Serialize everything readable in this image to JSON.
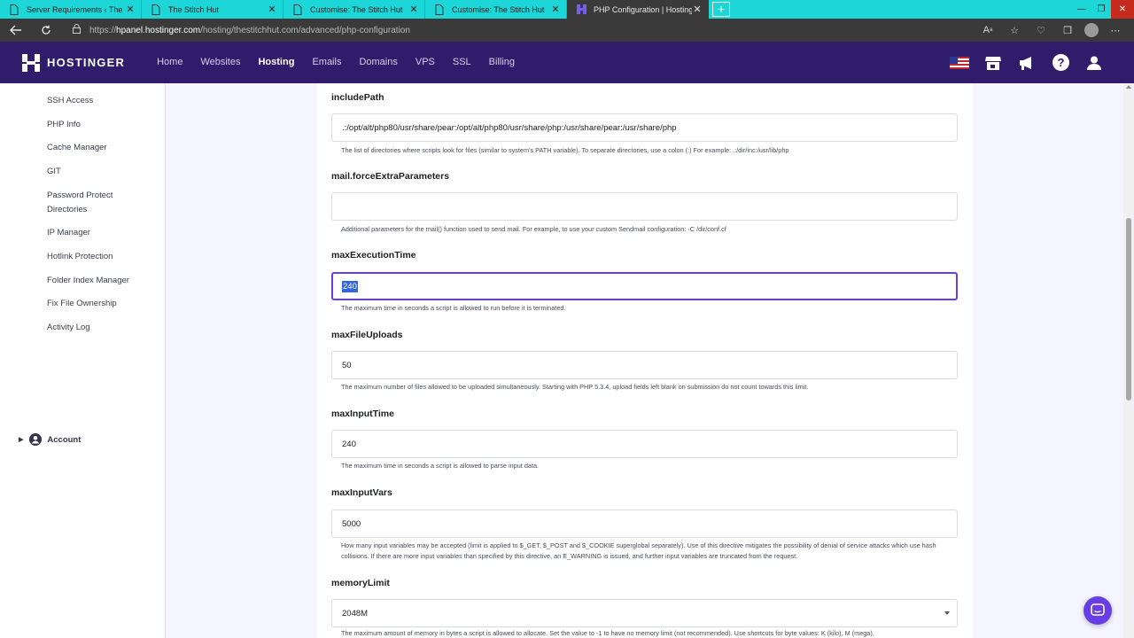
{
  "browser": {
    "tabs": [
      {
        "title": "Server Requirements ‹ The Stitch Hut",
        "active": false
      },
      {
        "title": "The Stitch Hut",
        "active": false
      },
      {
        "title": "Customise: The Stitch Hut",
        "active": false
      },
      {
        "title": "Customise: The Stitch Hut",
        "active": false
      },
      {
        "title": "PHP Configuration | Hostinger",
        "active": true
      }
    ],
    "new_tab": "+",
    "url_scheme": "https://",
    "url_host": "hpanel.hostinger.com",
    "url_path": "/hosting/thestitchhut.com/advanced/php-configuration"
  },
  "header": {
    "logo_text": "HOSTINGER",
    "nav": [
      "Home",
      "Websites",
      "Hosting",
      "Emails",
      "Domains",
      "VPS",
      "SSL",
      "Billing"
    ],
    "active_nav": "Hosting",
    "icons": [
      "us-flag-icon",
      "store-icon",
      "megaphone-icon",
      "help-icon",
      "user-icon"
    ]
  },
  "sidebar": {
    "items": [
      "SSH Access",
      "PHP Info",
      "Cache Manager",
      "GIT",
      "Password Protect Directories",
      "IP Manager",
      "Hotlink Protection",
      "Folder Index Manager",
      "Fix File Ownership",
      "Activity Log"
    ],
    "account_label": "Account"
  },
  "fields": {
    "includePath": {
      "label": "includePath",
      "value": ".:/opt/alt/php80/usr/share/pear:/opt/alt/php80/usr/share/php:/usr/share/pear:/usr/share/php",
      "help": "The list of directories where scripts look for files (similar to system's PATH variable). To separate directories, use a colon (:) For example: .:/dir/inc:/usr/lib/php"
    },
    "mailForceExtraParameters": {
      "label": "mail.forceExtraParameters",
      "value": "",
      "help": "Additional parameters for the mail() function used to send mail. For example, to use your custom Sendmail configuration: -C /dir/conf.cf"
    },
    "maxExecutionTime": {
      "label": "maxExecutionTime",
      "value": "240",
      "help": "The maximum time in seconds a script is allowed to run before it is terminated."
    },
    "maxFileUploads": {
      "label": "maxFileUploads",
      "value": "50",
      "help": "The maximum number of files allowed to be uploaded simultaneously. Starting with PHP 5.3.4, upload fields left blank on submission do not count towards this limit."
    },
    "maxInputTime": {
      "label": "maxInputTime",
      "value": "240",
      "help": "The maximum time in seconds a script is allowed to parse input data."
    },
    "maxInputVars": {
      "label": "maxInputVars",
      "value": "5000",
      "help": "How many input variables may be accepted (limit is applied to $_GET, $_POST and $_COOKIE superglobal separately). Use of this directive mitigates the possibility of denial of service attacks which use hash collisions. If there are more input variables than specified by this directive, an E_WARNING is issued, and further input variables are truncated from the request."
    },
    "memoryLimit": {
      "label": "memoryLimit",
      "value": "2048M",
      "help": "The maximum amount of memory in bytes a script is allowed to allocate. Set the value to -1 to have no memory limit (not recommended). Use shortcuts for byte values: K (kilo), M (mega),"
    }
  },
  "colors": {
    "brand_purple": "#673de6",
    "header_bg": "#2f1c6a",
    "tab_strip": "#1cd6d8"
  }
}
